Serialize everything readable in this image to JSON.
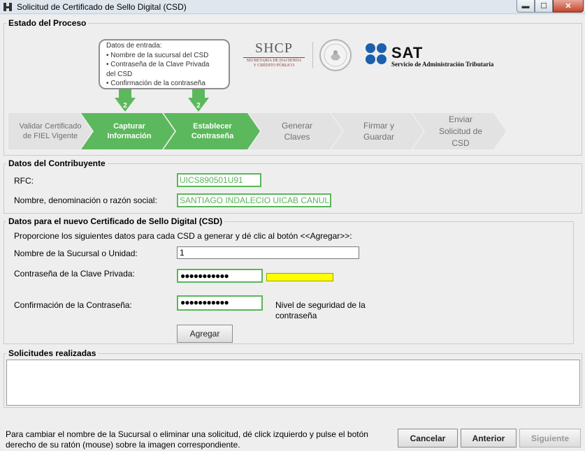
{
  "window": {
    "title": "Solicitud de Certificado de Sello Digital (CSD)",
    "minimize": "▬",
    "maximize": "☐",
    "close": "✕"
  },
  "proceso": {
    "title": "Estado del Proceso",
    "callout": {
      "lines": [
        "Datos de entrada:",
        "• Nombre de la sucursal del CSD",
        "• Contraseña de la Clave Privada",
        "del CSD",
        "• Confirmación de la contraseña"
      ]
    },
    "marker_number": "2",
    "logos": {
      "shcp": "SHCP",
      "shcp_sub": "SECRETARÍA DE HACIENDA\nY CRÉDITO PÚBLICO",
      "sat": "SAT",
      "sat_sub": "Servicio de Administración Tributaria"
    },
    "steps": [
      {
        "label": "Validar Certificado\nde FIEL Vigente",
        "state": "done"
      },
      {
        "label": "Capturar\nInformación",
        "state": "active"
      },
      {
        "label": "Establecer\nContraseña",
        "state": "active"
      },
      {
        "label": "Generar\nClaves",
        "state": "pending"
      },
      {
        "label": "Firmar y\nGuardar",
        "state": "pending"
      },
      {
        "label": "Enviar\nSolicitud de\nCSD",
        "state": "pending"
      }
    ],
    "colors": {
      "active": "#5cb85c",
      "inactive": "#e2e2e2",
      "green_text": "#5ab55a",
      "strength": "#ffff00"
    }
  },
  "contribuyente": {
    "title": "Datos del Contribuyente",
    "rfc_label": "RFC:",
    "rfc_value": "UICS890501U91",
    "nombre_label": "Nombre, denominación o razón social:",
    "nombre_value": "SANTIAGO INDALECIO UICAB CANUL"
  },
  "nuevo_csd": {
    "title": "Datos para el nuevo Certificado de Sello Digital (CSD)",
    "instructions": "Proporcione los siguientes datos para cada CSD a generar y dé clic al botón <<Agregar>>:",
    "sucursal_label": "Nombre de la Sucursal o Unidad:",
    "sucursal_value": "1",
    "contrasena_label": "Contraseña de la Clave Privada:",
    "contrasena_value": "●●●●●●●●●●●",
    "confirmacion_label": "Confirmación de la Contraseña:",
    "confirmacion_value": "●●●●●●●●●●●",
    "nivel_label": "Nivel de seguridad de la contraseña",
    "agregar_button": "Agregar"
  },
  "solicitudes": {
    "title": "Solicitudes realizadas"
  },
  "footer": {
    "help_text": "Para cambiar el nombre de la Sucursal o eliminar una solicitud, dé click izquierdo y pulse el botón derecho de su ratón (mouse) sobre la imagen correspondiente.",
    "cancel_button": "Cancelar",
    "back_button": "Anterior",
    "next_button": "Siguiente"
  }
}
